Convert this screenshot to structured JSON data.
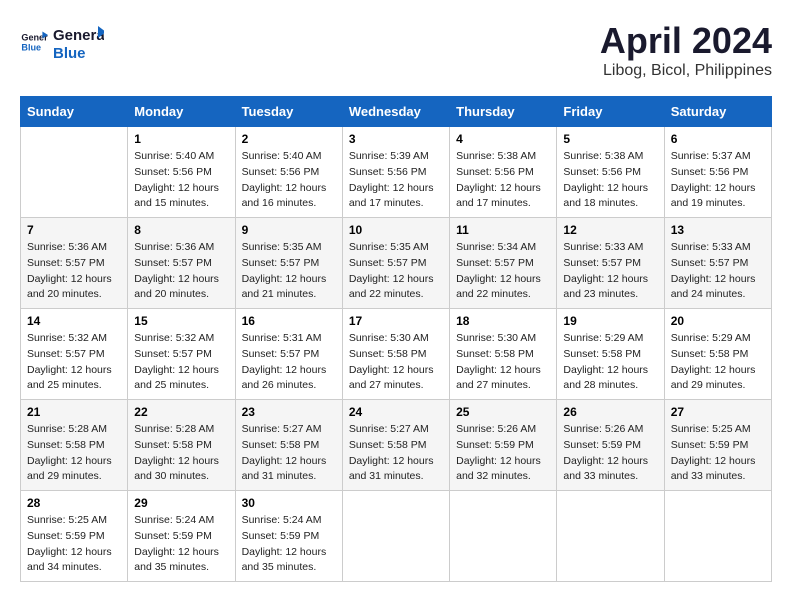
{
  "header": {
    "logo_line1": "General",
    "logo_line2": "Blue",
    "month": "April 2024",
    "location": "Libog, Bicol, Philippines"
  },
  "days_of_week": [
    "Sunday",
    "Monday",
    "Tuesday",
    "Wednesday",
    "Thursday",
    "Friday",
    "Saturday"
  ],
  "weeks": [
    [
      {
        "day": "",
        "sunrise": "",
        "sunset": "",
        "daylight": ""
      },
      {
        "day": "1",
        "sunrise": "5:40 AM",
        "sunset": "5:56 PM",
        "daylight": "12 hours and 15 minutes."
      },
      {
        "day": "2",
        "sunrise": "5:40 AM",
        "sunset": "5:56 PM",
        "daylight": "12 hours and 16 minutes."
      },
      {
        "day": "3",
        "sunrise": "5:39 AM",
        "sunset": "5:56 PM",
        "daylight": "12 hours and 17 minutes."
      },
      {
        "day": "4",
        "sunrise": "5:38 AM",
        "sunset": "5:56 PM",
        "daylight": "12 hours and 17 minutes."
      },
      {
        "day": "5",
        "sunrise": "5:38 AM",
        "sunset": "5:56 PM",
        "daylight": "12 hours and 18 minutes."
      },
      {
        "day": "6",
        "sunrise": "5:37 AM",
        "sunset": "5:56 PM",
        "daylight": "12 hours and 19 minutes."
      }
    ],
    [
      {
        "day": "7",
        "sunrise": "5:36 AM",
        "sunset": "5:57 PM",
        "daylight": "12 hours and 20 minutes."
      },
      {
        "day": "8",
        "sunrise": "5:36 AM",
        "sunset": "5:57 PM",
        "daylight": "12 hours and 20 minutes."
      },
      {
        "day": "9",
        "sunrise": "5:35 AM",
        "sunset": "5:57 PM",
        "daylight": "12 hours and 21 minutes."
      },
      {
        "day": "10",
        "sunrise": "5:35 AM",
        "sunset": "5:57 PM",
        "daylight": "12 hours and 22 minutes."
      },
      {
        "day": "11",
        "sunrise": "5:34 AM",
        "sunset": "5:57 PM",
        "daylight": "12 hours and 22 minutes."
      },
      {
        "day": "12",
        "sunrise": "5:33 AM",
        "sunset": "5:57 PM",
        "daylight": "12 hours and 23 minutes."
      },
      {
        "day": "13",
        "sunrise": "5:33 AM",
        "sunset": "5:57 PM",
        "daylight": "12 hours and 24 minutes."
      }
    ],
    [
      {
        "day": "14",
        "sunrise": "5:32 AM",
        "sunset": "5:57 PM",
        "daylight": "12 hours and 25 minutes."
      },
      {
        "day": "15",
        "sunrise": "5:32 AM",
        "sunset": "5:57 PM",
        "daylight": "12 hours and 25 minutes."
      },
      {
        "day": "16",
        "sunrise": "5:31 AM",
        "sunset": "5:57 PM",
        "daylight": "12 hours and 26 minutes."
      },
      {
        "day": "17",
        "sunrise": "5:30 AM",
        "sunset": "5:58 PM",
        "daylight": "12 hours and 27 minutes."
      },
      {
        "day": "18",
        "sunrise": "5:30 AM",
        "sunset": "5:58 PM",
        "daylight": "12 hours and 27 minutes."
      },
      {
        "day": "19",
        "sunrise": "5:29 AM",
        "sunset": "5:58 PM",
        "daylight": "12 hours and 28 minutes."
      },
      {
        "day": "20",
        "sunrise": "5:29 AM",
        "sunset": "5:58 PM",
        "daylight": "12 hours and 29 minutes."
      }
    ],
    [
      {
        "day": "21",
        "sunrise": "5:28 AM",
        "sunset": "5:58 PM",
        "daylight": "12 hours and 29 minutes."
      },
      {
        "day": "22",
        "sunrise": "5:28 AM",
        "sunset": "5:58 PM",
        "daylight": "12 hours and 30 minutes."
      },
      {
        "day": "23",
        "sunrise": "5:27 AM",
        "sunset": "5:58 PM",
        "daylight": "12 hours and 31 minutes."
      },
      {
        "day": "24",
        "sunrise": "5:27 AM",
        "sunset": "5:58 PM",
        "daylight": "12 hours and 31 minutes."
      },
      {
        "day": "25",
        "sunrise": "5:26 AM",
        "sunset": "5:59 PM",
        "daylight": "12 hours and 32 minutes."
      },
      {
        "day": "26",
        "sunrise": "5:26 AM",
        "sunset": "5:59 PM",
        "daylight": "12 hours and 33 minutes."
      },
      {
        "day": "27",
        "sunrise": "5:25 AM",
        "sunset": "5:59 PM",
        "daylight": "12 hours and 33 minutes."
      }
    ],
    [
      {
        "day": "28",
        "sunrise": "5:25 AM",
        "sunset": "5:59 PM",
        "daylight": "12 hours and 34 minutes."
      },
      {
        "day": "29",
        "sunrise": "5:24 AM",
        "sunset": "5:59 PM",
        "daylight": "12 hours and 35 minutes."
      },
      {
        "day": "30",
        "sunrise": "5:24 AM",
        "sunset": "5:59 PM",
        "daylight": "12 hours and 35 minutes."
      },
      {
        "day": "",
        "sunrise": "",
        "sunset": "",
        "daylight": ""
      },
      {
        "day": "",
        "sunrise": "",
        "sunset": "",
        "daylight": ""
      },
      {
        "day": "",
        "sunrise": "",
        "sunset": "",
        "daylight": ""
      },
      {
        "day": "",
        "sunrise": "",
        "sunset": "",
        "daylight": ""
      }
    ]
  ],
  "labels": {
    "sunrise_prefix": "Sunrise: ",
    "sunset_prefix": "Sunset: ",
    "daylight_prefix": "Daylight: "
  }
}
